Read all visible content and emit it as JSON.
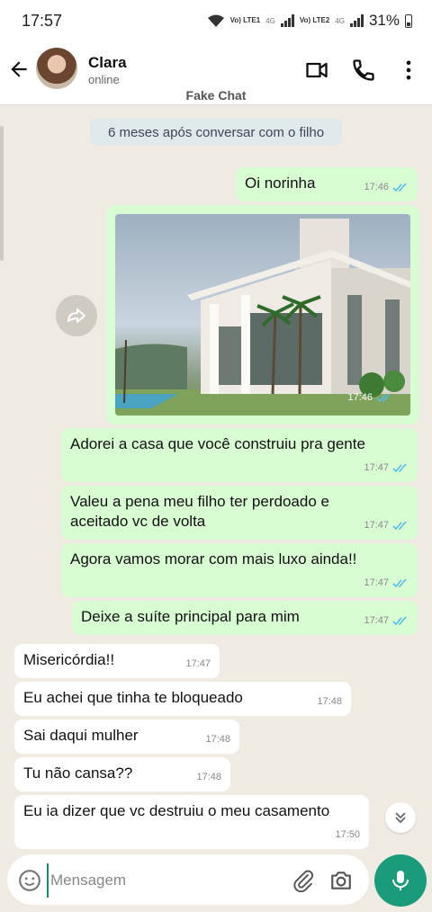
{
  "status": {
    "time": "17:57",
    "sim1": "Vo) LTE1",
    "sim1_net": "4G",
    "sim2": "Vo) LTE2",
    "sim2_net": "4G",
    "battery": "31%"
  },
  "header": {
    "name": "Clara",
    "presence": "online",
    "subtitle": "Fake Chat"
  },
  "chip": "6 meses após conversar com o filho",
  "messages": [
    {
      "text": "Oi norinha",
      "time": "17:46"
    },
    {
      "text": "17:46"
    },
    {
      "text": "Adorei a casa que você construiu pra gente",
      "time": "17:47"
    },
    {
      "text": "Valeu a pena meu filho ter perdoado e aceitado vc de volta",
      "time": "17:47"
    },
    {
      "text": "Agora vamos morar com mais luxo ainda!!",
      "time": "17:47"
    },
    {
      "text": "Deixe a suíte principal para mim",
      "time": "17:47"
    },
    {
      "text": "Misericórdia!!",
      "time": "17:47"
    },
    {
      "text": "Eu achei que tinha te bloqueado",
      "time": "17:48"
    },
    {
      "text": "Sai daqui mulher",
      "time": "17:48"
    },
    {
      "text": "Tu não cansa??",
      "time": "17:48"
    },
    {
      "text": "Eu ia dizer que vc destruiu o meu casamento",
      "time": "17:50"
    }
  ],
  "input": {
    "placeholder": "Mensagem"
  },
  "colors": {
    "accent": "#1a9b79",
    "outgoing": "#d9fdd3",
    "incoming": "#ffffff",
    "read_ticks": "#53bdeb"
  }
}
